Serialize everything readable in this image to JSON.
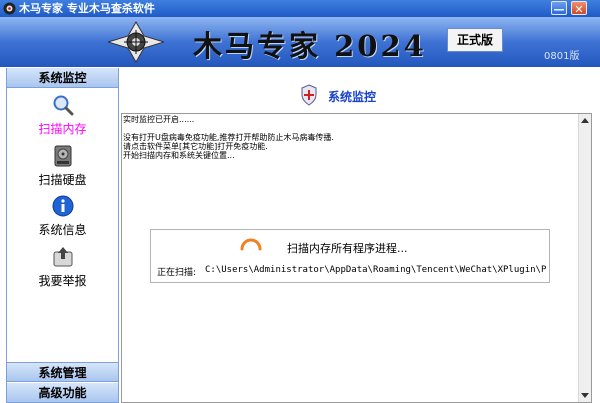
{
  "window": {
    "title": "木马专家  专业木马查杀软件",
    "minimize_glyph": "—",
    "close_glyph": "✕"
  },
  "banner": {
    "brand": "木马专家 2024",
    "edition": "正式版",
    "version": "0801版"
  },
  "sidebar": {
    "header_top": "系统监控",
    "items": [
      {
        "label": "扫描内存",
        "icon": "magnifier-icon"
      },
      {
        "label": "扫描硬盘",
        "icon": "disk-icon"
      },
      {
        "label": "系统信息",
        "icon": "info-icon"
      },
      {
        "label": "我要举报",
        "icon": "report-icon"
      }
    ],
    "header_mgmt": "系统管理",
    "header_adv": "高级功能"
  },
  "main": {
    "title": "系统监控",
    "log_lines": [
      "实时监控已开启......",
      "",
      "没有打开U盘病毒免疫功能,推荐打开帮助防止木马病毒传播.",
      "请点击软件菜单[其它功能]打开免疫功能.",
      "开始扫描内存和系统关键位置..."
    ]
  },
  "scan": {
    "message": "扫描内存所有程序进程...",
    "current_label": "正在扫描:",
    "current_path": "C:\\Users\\Administrator\\AppData\\Roaming\\Tencent\\WeChat\\XPlugin\\Plu"
  },
  "colors": {
    "title_bar": "#2f6ad6",
    "accent_active": "#ff00ff",
    "main_title": "#1a44c8",
    "spinner": "#f08020"
  }
}
